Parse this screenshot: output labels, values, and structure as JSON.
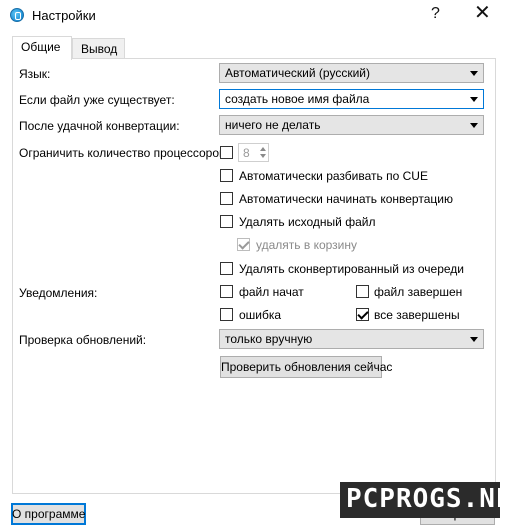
{
  "window": {
    "title": "Настройки",
    "help_glyph": "?",
    "close_glyph": "✕"
  },
  "tabs": [
    {
      "label": "Общие",
      "active": true
    },
    {
      "label": "Вывод",
      "active": false
    }
  ],
  "general": {
    "language_label": "Язык:",
    "language_value": "Автоматический (русский)",
    "if_exists_label": "Если файл уже существует:",
    "if_exists_value": "создать новое имя файла",
    "after_convert_label": "После удачной конвертации:",
    "after_convert_value": "ничего не делать",
    "limit_cpu_label": "Ограничить количество процессоров:",
    "limit_cpu_checked": false,
    "cpu_count": "8",
    "split_cue_label": "Автоматически разбивать по CUE",
    "auto_start_label": "Автоматически начинать конвертацию",
    "delete_source_label": "Удалять исходный файл",
    "to_recycle_label": "удалять в корзину",
    "to_recycle_checked": true,
    "remove_from_queue_label": "Удалять сконвертированный из очереди",
    "notifications_label": "Уведомления:",
    "notify_file_started": "файл начат",
    "notify_file_finished": "файл завершен",
    "notify_error": "ошибка",
    "notify_all_finished": "все завершены",
    "notify_all_finished_checked": true,
    "updates_label": "Проверка обновлений:",
    "updates_value": "только вручную",
    "check_updates_button": "Проверить обновления сейчас"
  },
  "footer": {
    "about_button": "О программе",
    "close_button": "Закрыть"
  },
  "watermark": {
    "text": "PCPROGS.NET"
  },
  "colors": {
    "accent": "#0078d7",
    "button_bg": "#e1e1e1",
    "combo_bg": "#e5e5e5"
  }
}
